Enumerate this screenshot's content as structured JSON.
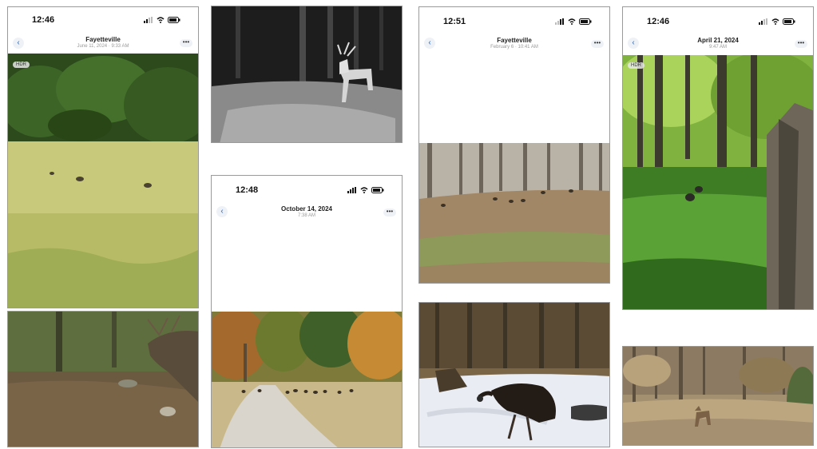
{
  "screens": {
    "phone1": {
      "time": "12:46",
      "title": "Fayetteville",
      "subtitle": "June 11, 2024 · 9:33 AM",
      "badge": "HDR"
    },
    "phone2": {
      "time": "12:48",
      "title": "October 14, 2024",
      "subtitle": "7:38 AM"
    },
    "phone3": {
      "time": "12:51",
      "title": "Fayetteville",
      "subtitle": "February 6 · 10:41 AM"
    },
    "phone4": {
      "time": "12:46",
      "title": "April 21, 2024",
      "subtitle": "9:47 AM",
      "badge": "HDR"
    }
  },
  "icons": {
    "back": "chevron-left-icon",
    "more": "ellipsis-icon",
    "signal": "signal-icon",
    "wifi": "wifi-icon",
    "battery": "battery-icon"
  },
  "glyphs": {
    "back": "‹",
    "more": "•••"
  }
}
